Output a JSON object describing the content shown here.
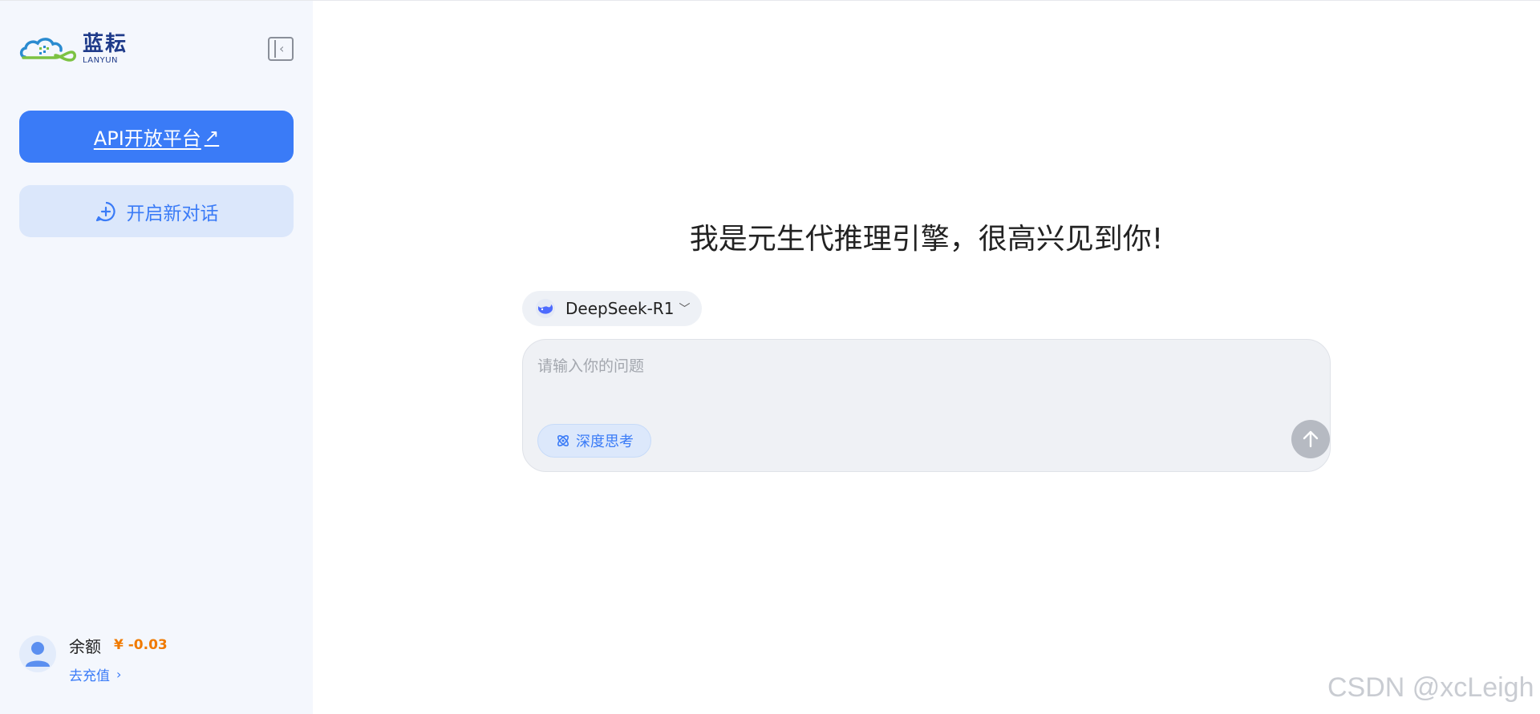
{
  "sidebar": {
    "logo": {
      "cn": "蓝耘",
      "en": "LANYUN"
    },
    "api_button": {
      "label": "API开放平台",
      "icon": "external-link-icon"
    },
    "new_chat_button": {
      "label": "开启新对话",
      "icon": "chat-plus-icon"
    },
    "account": {
      "balance_label": "余额",
      "balance_value": "¥ -0.03",
      "recharge_label": "去充值"
    }
  },
  "main": {
    "greeting": "我是元生代推理引擎，很高兴见到你!",
    "model": {
      "name": "DeepSeek-R1",
      "icon": "whale-icon"
    },
    "input": {
      "placeholder": "请输入你的问题",
      "value": ""
    },
    "deep_think_label": "深度思考",
    "send_icon": "arrow-up-icon"
  },
  "watermark": "CSDN @xcLeigh",
  "colors": {
    "accent": "#3a7bf7",
    "sidebar_bg": "#f4f7fd",
    "balance": "#f07a00"
  }
}
